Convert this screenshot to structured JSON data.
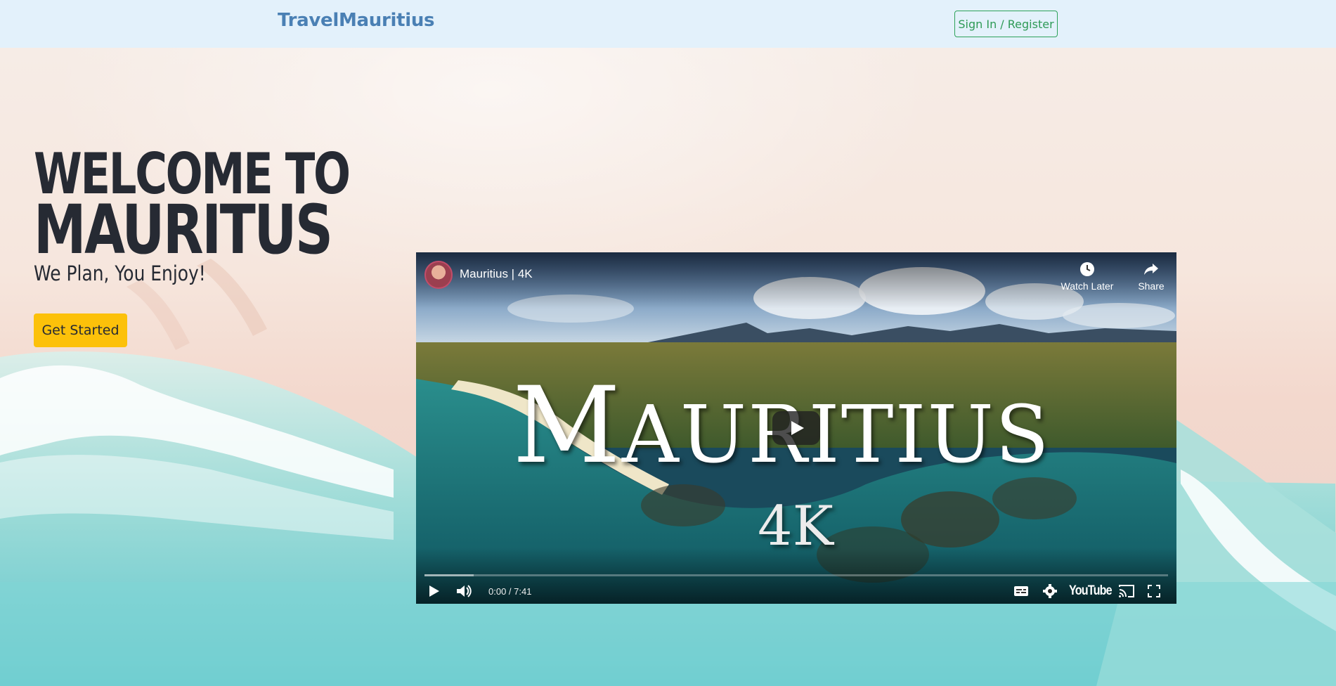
{
  "nav": {
    "brand": "TravelMauritius",
    "signin_label": "Sign In / Register"
  },
  "hero": {
    "title_line1": "WELCOME TO",
    "title_line2": "MAURITUS",
    "tagline": "We Plan, You Enjoy!",
    "cta_label": "Get Started"
  },
  "video": {
    "title": "Mauritius | 4K",
    "watch_later_label": "Watch Later",
    "share_label": "Share",
    "overlay_title_first": "M",
    "overlay_title_rest": "AURITIUS",
    "overlay_subtitle": "4K",
    "time": "0:00 / 7:41",
    "brand": "YouTube"
  },
  "colors": {
    "nav_bg": "#e3f1fb",
    "brand": "#4a80b4",
    "signin_border": "#2ea25a",
    "cta_bg": "#fcc10a",
    "text_dark": "#262a33"
  },
  "icons": [
    "clock-icon",
    "share-arrow-icon",
    "play-icon",
    "volume-icon",
    "captions-icon",
    "gear-icon",
    "cast-icon",
    "fullscreen-icon"
  ]
}
